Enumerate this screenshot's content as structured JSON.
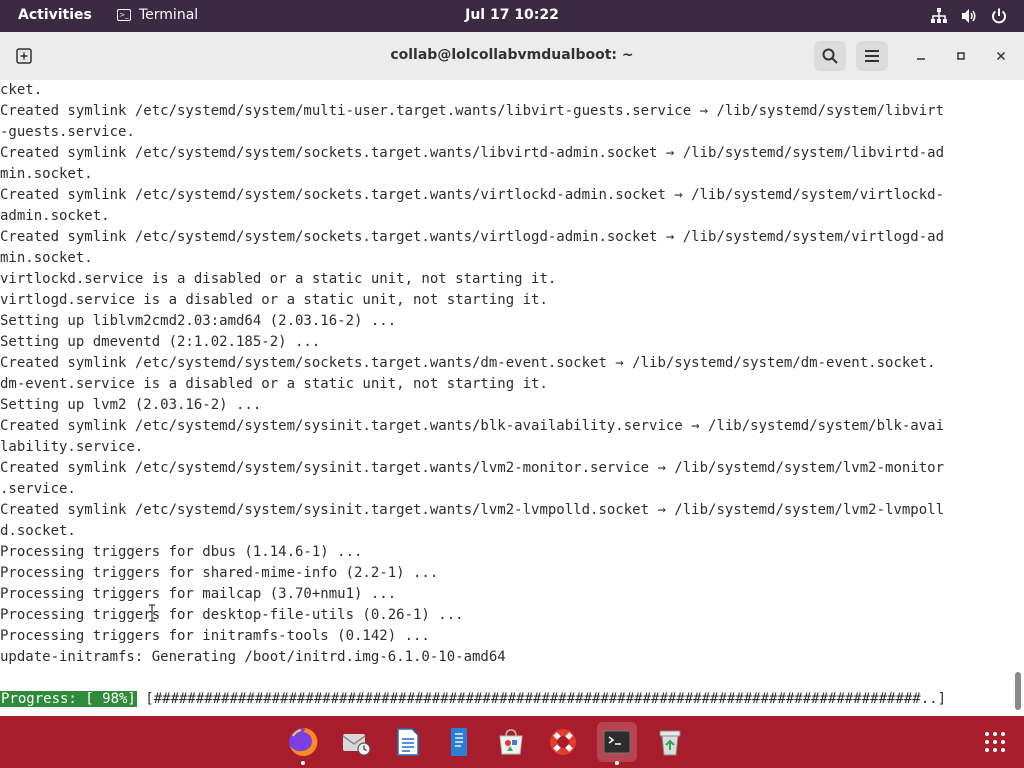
{
  "topbar": {
    "activities": "Activities",
    "app_name": "Terminal",
    "clock": "Jul 17  10:22"
  },
  "window": {
    "title": "collab@lolcollabvmdualboot: ~"
  },
  "terminal": {
    "lines": [
      "cket.",
      "Created symlink /etc/systemd/system/multi-user.target.wants/libvirt-guests.service → /lib/systemd/system/libvirt",
      "-guests.service.",
      "Created symlink /etc/systemd/system/sockets.target.wants/libvirtd-admin.socket → /lib/systemd/system/libvirtd-ad",
      "min.socket.",
      "Created symlink /etc/systemd/system/sockets.target.wants/virtlockd-admin.socket → /lib/systemd/system/virtlockd-",
      "admin.socket.",
      "Created symlink /etc/systemd/system/sockets.target.wants/virtlogd-admin.socket → /lib/systemd/system/virtlogd-ad",
      "min.socket.",
      "virtlockd.service is a disabled or a static unit, not starting it.",
      "virtlogd.service is a disabled or a static unit, not starting it.",
      "Setting up liblvm2cmd2.03:amd64 (2.03.16-2) ...",
      "Setting up dmeventd (2:1.02.185-2) ...",
      "Created symlink /etc/systemd/system/sockets.target.wants/dm-event.socket → /lib/systemd/system/dm-event.socket.",
      "dm-event.service is a disabled or a static unit, not starting it.",
      "Setting up lvm2 (2.03.16-2) ...",
      "Created symlink /etc/systemd/system/sysinit.target.wants/blk-availability.service → /lib/systemd/system/blk-avai",
      "lability.service.",
      "Created symlink /etc/systemd/system/sysinit.target.wants/lvm2-monitor.service → /lib/systemd/system/lvm2-monitor",
      ".service.",
      "Created symlink /etc/systemd/system/sysinit.target.wants/lvm2-lvmpolld.socket → /lib/systemd/system/lvm2-lvmpoll",
      "d.socket.",
      "Processing triggers for dbus (1.14.6-1) ...",
      "Processing triggers for shared-mime-info (2.2-1) ...",
      "Processing triggers for mailcap (3.70+nmu1) ...",
      "Processing triggers for desktop-file-utils (0.26-1) ...",
      "Processing triggers for initramfs-tools (0.142) ...",
      "update-initramfs: Generating /boot/initrd.img-6.1.0-10-amd64"
    ],
    "progress_label": "Progress: [ 98%]",
    "progress_bar": " [###########################################################################################..] ",
    "progress_percent": 98
  },
  "colors": {
    "topbar_bg": "#3b2a41",
    "dock_bg": "#a81d2b",
    "progress_bg": "#2e8b3a",
    "terminal_bg": "#ffffff"
  },
  "dock": {
    "apps": [
      {
        "icon": "firefox-icon"
      },
      {
        "icon": "mail-icon"
      },
      {
        "icon": "writer-document-icon"
      },
      {
        "icon": "text-editor-icon"
      },
      {
        "icon": "software-store-icon"
      },
      {
        "icon": "help-lifebuoy-icon"
      },
      {
        "icon": "terminal-icon"
      },
      {
        "icon": "trash-icon"
      }
    ]
  }
}
